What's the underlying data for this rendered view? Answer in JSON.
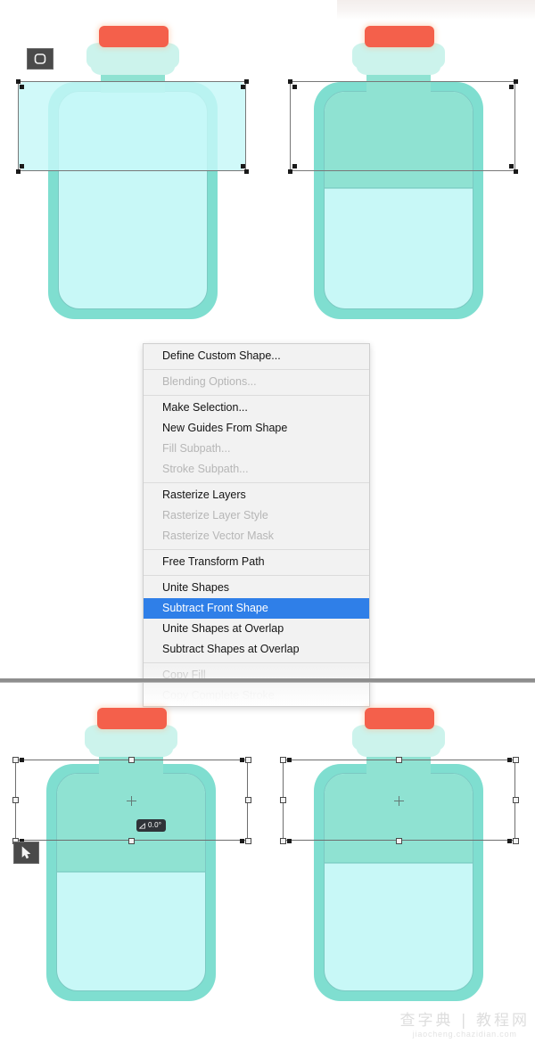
{
  "app": {
    "title": "Photoshop shape subtract tutorial screenshot",
    "canvas_background": "#ffffff",
    "divider_color": "#8e8e8e"
  },
  "colors": {
    "cap_red": "#f4604b",
    "bottle_shell_mint": "#7fded0",
    "liquid_light_cyan": "#c8f8f7",
    "liquid_dark_teal": "#8fe2d2",
    "collar_pale_mint": "#ccf3ec",
    "menu_highlight_blue": "#2f7fe8",
    "menu_background": "#f2f2f2",
    "menu_text": "#131313",
    "menu_text_disabled": "#b6b6b6",
    "selection_stroke": "#6e6e6e",
    "tooltip_background": "#2f3338"
  },
  "context_menu": {
    "groups": [
      {
        "items": [
          {
            "label": "Define Custom Shape...",
            "state": "enabled"
          }
        ]
      },
      {
        "items": [
          {
            "label": "Blending Options...",
            "state": "disabled"
          }
        ]
      },
      {
        "items": [
          {
            "label": "Make Selection...",
            "state": "enabled"
          },
          {
            "label": "New Guides From Shape",
            "state": "enabled"
          },
          {
            "label": "Fill Subpath...",
            "state": "disabled"
          },
          {
            "label": "Stroke Subpath...",
            "state": "disabled"
          }
        ]
      },
      {
        "items": [
          {
            "label": "Rasterize Layers",
            "state": "enabled"
          },
          {
            "label": "Rasterize Layer Style",
            "state": "disabled"
          },
          {
            "label": "Rasterize Vector Mask",
            "state": "disabled"
          }
        ]
      },
      {
        "items": [
          {
            "label": "Free Transform Path",
            "state": "enabled"
          }
        ]
      },
      {
        "items": [
          {
            "label": "Unite Shapes",
            "state": "enabled"
          },
          {
            "label": "Subtract Front Shape",
            "state": "selected"
          },
          {
            "label": "Unite Shapes at Overlap",
            "state": "enabled"
          },
          {
            "label": "Subtract Shapes at Overlap",
            "state": "enabled"
          }
        ]
      },
      {
        "items": [
          {
            "label": "Copy Fill",
            "state": "disabled"
          },
          {
            "label": "Copy Complete Stroke",
            "state": "disabled"
          }
        ]
      }
    ]
  },
  "panels": [
    {
      "id": "top-left",
      "note": "Rounded rectangle shape drawn over the bottle, path selected",
      "cursor_icon": "rounded-rectangle-tool-icon",
      "fill_ratio": 0.0,
      "has_overlay_shape": true,
      "has_angle_tooltip": false
    },
    {
      "id": "top-right",
      "note": "Result after Subtract Front Shape, upper area dark teal",
      "cursor_icon": null,
      "fill_ratio": 0.33,
      "has_overlay_shape": false,
      "has_angle_tooltip": false
    },
    {
      "id": "bottom-left",
      "note": "Free Transform Path dragging bottom handle downward",
      "cursor_icon": "path-selection-arrow-icon",
      "fill_ratio": 0.44,
      "has_overlay_shape": false,
      "has_angle_tooltip": true
    },
    {
      "id": "bottom-right",
      "note": "Transform committed, fill level set",
      "cursor_icon": null,
      "fill_ratio": 0.4,
      "has_overlay_shape": false,
      "has_angle_tooltip": false
    }
  ],
  "angle_tooltip": {
    "icon": "rotate-angle-icon",
    "value": "0.0°"
  },
  "watermark": {
    "cn_text": "查字典 | 教程网",
    "url": "jiaocheng.chazidian.com"
  }
}
